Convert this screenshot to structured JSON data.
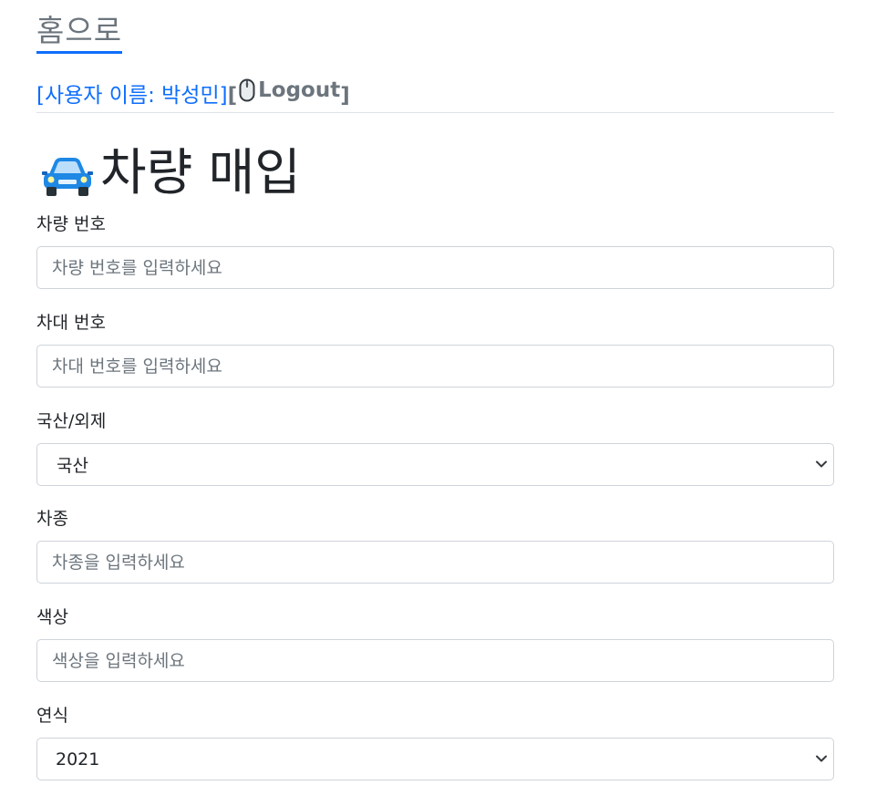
{
  "nav": {
    "home_label": "홈으로",
    "user_name_label": "[사용자 이름: 박성민]",
    "logout_open_bracket": "[",
    "logout_label": "Logout",
    "logout_close_bracket": "]"
  },
  "page": {
    "title": "차량 매입"
  },
  "form": {
    "car_number": {
      "label": "차량 번호",
      "value": "",
      "placeholder": "차량 번호를 입력하세요"
    },
    "chassis_number": {
      "label": "차대 번호",
      "value": "",
      "placeholder": "차대 번호를 입력하세요"
    },
    "origin": {
      "label": "국산/외제",
      "selected": "국산"
    },
    "model": {
      "label": "차종",
      "value": "",
      "placeholder": "차종을 입력하세요"
    },
    "color": {
      "label": "색상",
      "value": "",
      "placeholder": "색상을 입력하세요"
    },
    "year": {
      "label": "연식",
      "selected": "2021"
    }
  },
  "icons": {
    "mouse": "computer-mouse-icon",
    "car": "automobile-icon",
    "chevron": "chevron-down-icon"
  },
  "colors": {
    "link": "#0d6efd",
    "muted": "#6c757d",
    "border": "#ced4da"
  }
}
